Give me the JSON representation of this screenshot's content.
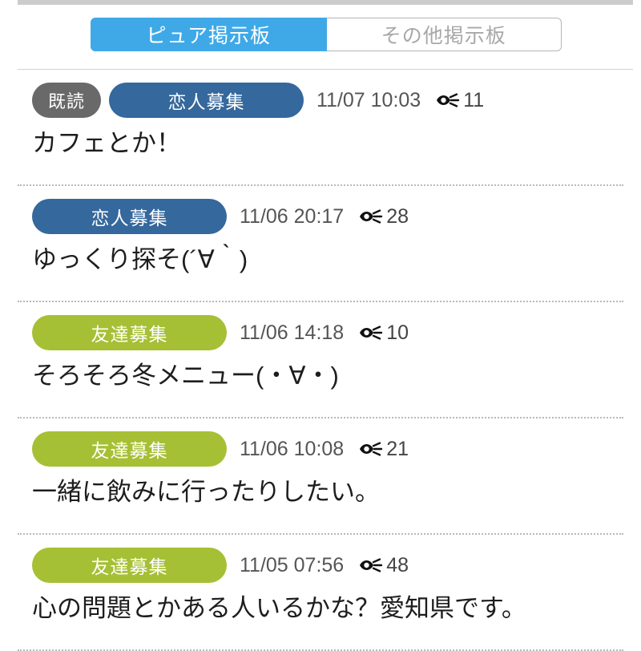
{
  "tabs": [
    {
      "label": "ピュア掲示板",
      "active": true,
      "name": "tab-pure-board"
    },
    {
      "label": "その他掲示板",
      "active": false,
      "name": "tab-other-board"
    }
  ],
  "icons": {
    "eye": "eye-icon"
  },
  "colors": {
    "tab_active_bg": "#3fa9e8",
    "tab_inactive_text": "#a8a8a8",
    "badge_read_bg": "#696969",
    "badge_blue_bg": "#35689c",
    "badge_green_bg": "#a5c034",
    "body_text": "#1d1d1d",
    "meta_text": "#555555"
  },
  "posts": [
    {
      "read_label": "既読",
      "category": "恋人募集",
      "category_color": "blue",
      "timestamp": "11/07 10:03",
      "views": "11",
      "body": "カフェとか！"
    },
    {
      "read_label": "",
      "category": "恋人募集",
      "category_color": "blue",
      "timestamp": "11/06 20:17",
      "views": "28",
      "body": "ゆっくり探そ(´∀｀)"
    },
    {
      "read_label": "",
      "category": "友達募集",
      "category_color": "green",
      "timestamp": "11/06 14:18",
      "views": "10",
      "body": "そろそろ冬メニュー(・∀・)"
    },
    {
      "read_label": "",
      "category": "友達募集",
      "category_color": "green",
      "timestamp": "11/06 10:08",
      "views": "21",
      "body": "一緒に飲みに行ったりしたい。"
    },
    {
      "read_label": "",
      "category": "友達募集",
      "category_color": "green",
      "timestamp": "11/05 07:56",
      "views": "48",
      "body": "心の問題とかある人いるかな？愛知県です。"
    }
  ]
}
